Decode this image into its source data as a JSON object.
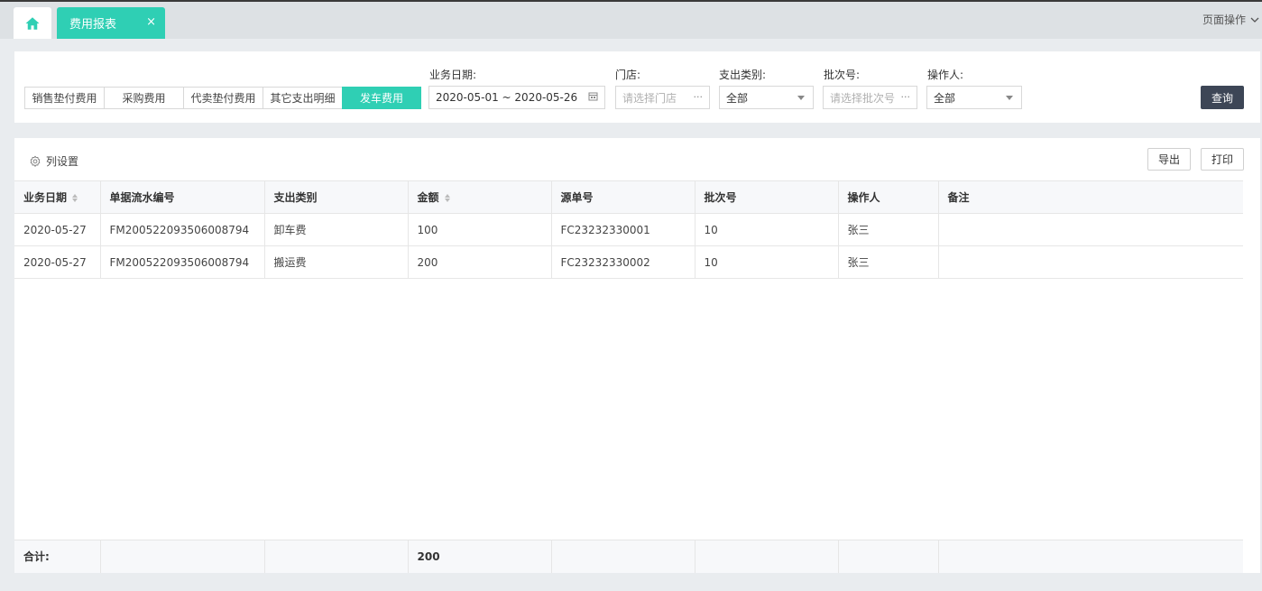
{
  "tabs": {
    "home_icon": "home-icon",
    "active_tab": "费用报表",
    "close_glyph": "×",
    "page_ops": "页面操作"
  },
  "filters": {
    "type_buttons": [
      "销售垫付费用",
      "采购费用",
      "代卖垫付费用",
      "其它支出明细",
      "发车费用"
    ],
    "active_type": "发车费用",
    "date_label": "业务日期:",
    "date_value": "2020-05-01 ~ 2020-05-26",
    "store_label": "门店:",
    "store_placeholder": "请选择门店",
    "expense_type_label": "支出类别:",
    "expense_type_value": "全部",
    "batch_label": "批次号:",
    "batch_placeholder": "请选择批次号",
    "operator_label": "操作人:",
    "operator_value": "全部",
    "query_label": "查询"
  },
  "toolbar": {
    "col_settings": "列设置",
    "export": "导出",
    "print": "打印"
  },
  "table": {
    "headers": [
      "业务日期",
      "单据流水编号",
      "支出类别",
      "金额",
      "源单号",
      "批次号",
      "操作人",
      "备注"
    ],
    "rows": [
      [
        "2020-05-27",
        "FM200522093506008794",
        "卸车费",
        "100",
        "FC23232330001",
        "10",
        "张三",
        ""
      ],
      [
        "2020-05-27",
        "FM200522093506008794",
        "搬运费",
        "200",
        "FC23232330002",
        "10",
        "张三",
        ""
      ]
    ],
    "footer_label": "合计:",
    "footer_amount": "200"
  },
  "colors": {
    "accent": "#2fcfb4",
    "query_button": "#3d4656"
  }
}
